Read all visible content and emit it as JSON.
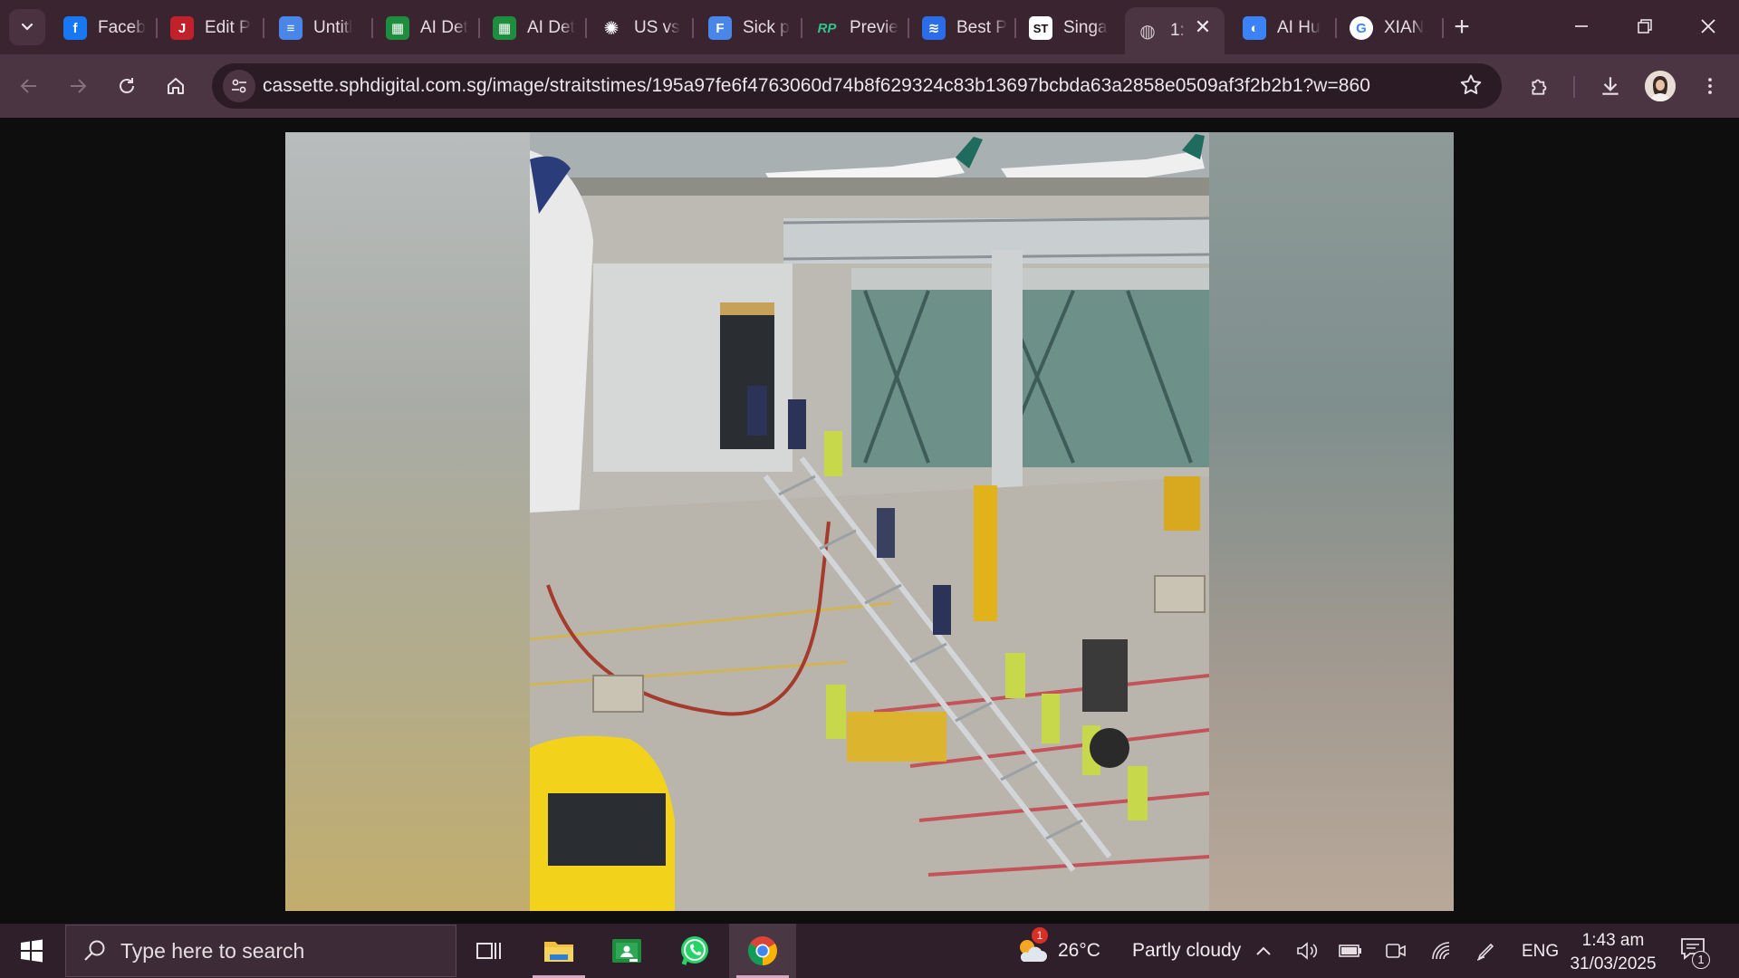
{
  "browser": {
    "tabs": [
      {
        "title": "Faceb",
        "icon": "facebook-icon",
        "color": "#1877f2"
      },
      {
        "title": "Edit P",
        "icon": "editor-icon",
        "color": "#c0212a"
      },
      {
        "title": "Untitl",
        "icon": "google-docs-icon",
        "color": "#4a86e8"
      },
      {
        "title": "AI Det",
        "icon": "google-sheets-icon",
        "color": "#1e8e3e"
      },
      {
        "title": "AI Det",
        "icon": "google-sheets-icon",
        "color": "#1e8e3e"
      },
      {
        "title": "US vs",
        "icon": "openai-icon",
        "color": "#ffffff"
      },
      {
        "title": "Sick p",
        "icon": "google-forms-doc-icon",
        "color": "#4a86e8"
      },
      {
        "title": "Previe",
        "icon": "rp-icon",
        "color": "#34c28a"
      },
      {
        "title": "Best P",
        "icon": "best-picks-icon",
        "color": "#2b6de8"
      },
      {
        "title": "Singa",
        "icon": "straits-times-icon",
        "color": "#ffffff"
      },
      {
        "title": "1:",
        "icon": "globe-icon",
        "color": "#cfc6cb",
        "active": true
      },
      {
        "title": "AI Hu",
        "icon": "ai-humanizer-icon",
        "color": "#3b82f6"
      },
      {
        "title": "XIAN",
        "icon": "google-icon",
        "color": "#ffffff"
      }
    ],
    "url": "cassette.sphdigital.com.sg/image/straitstimes/195a97fe6f4763060d74b8f629324c83b13697bcbda63a2858e0509af3f2b2b1?w=860"
  },
  "image": {
    "description_icon": "airport-jet-bridge-photo"
  },
  "taskbar": {
    "search_placeholder": "Type here to search",
    "weather_temp": "26°C",
    "weather_text": "Partly cloudy",
    "weather_badge": "1",
    "language": "ENG",
    "time": "1:43 am",
    "date": "31/03/2025",
    "notification_count": "1"
  }
}
